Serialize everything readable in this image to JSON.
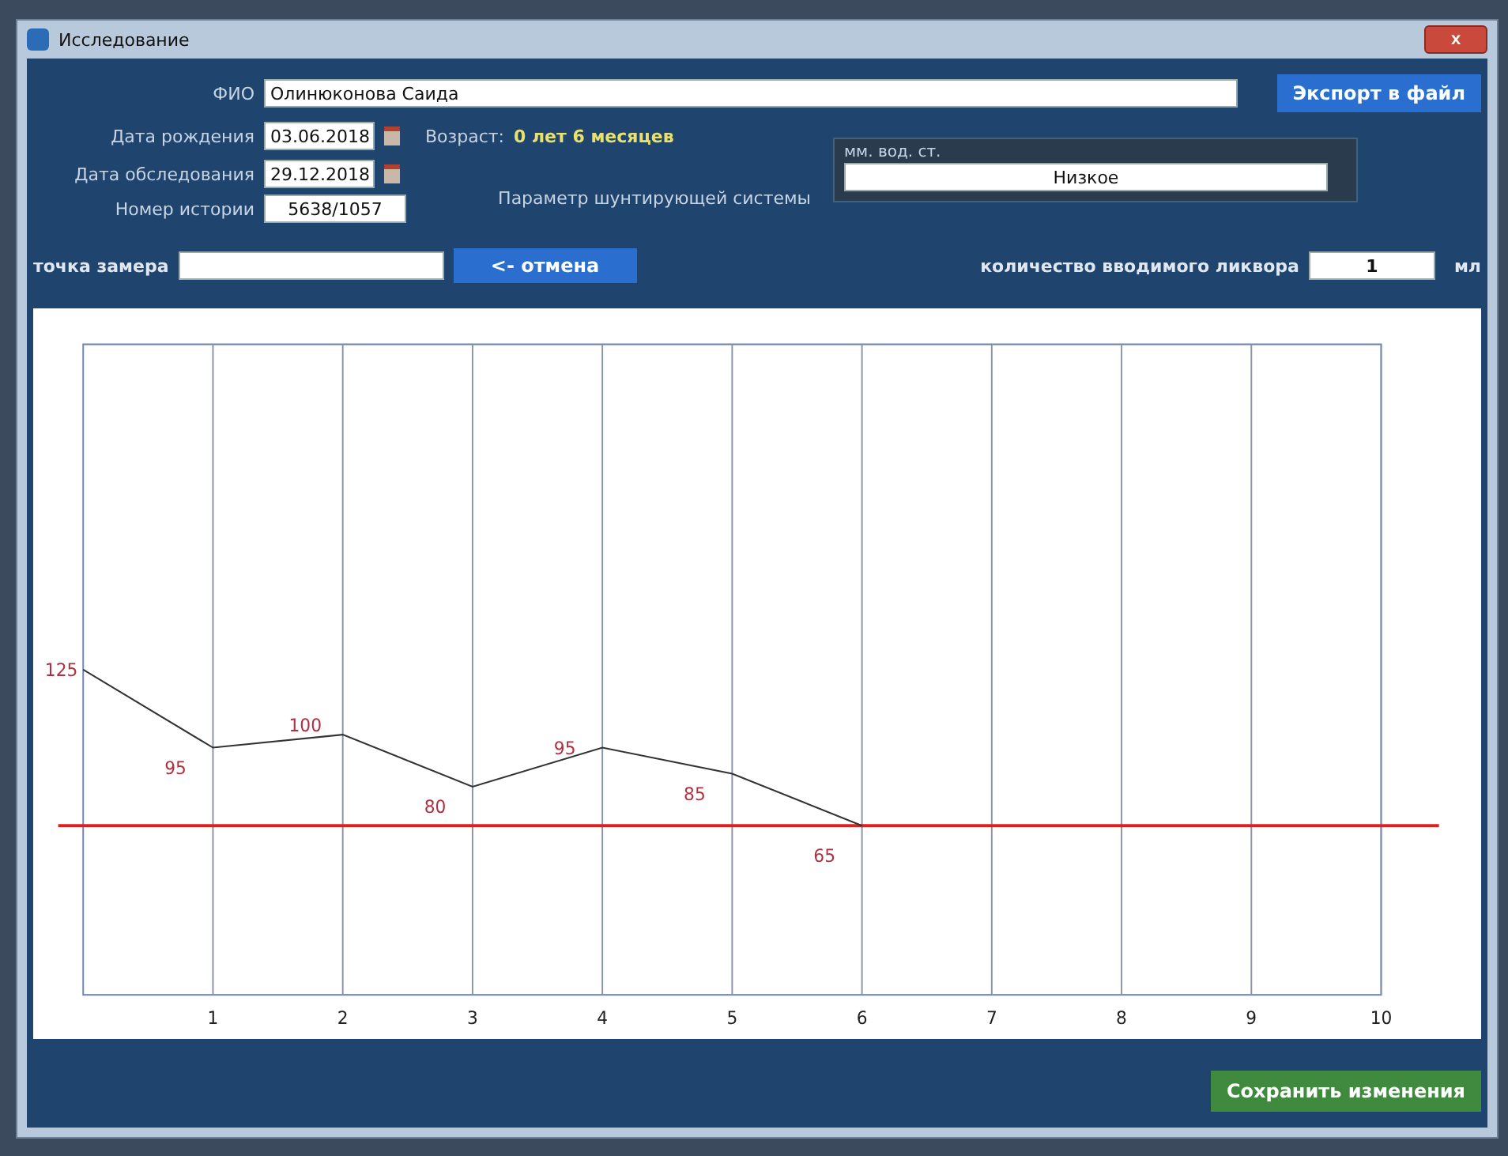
{
  "window": {
    "title": "Исследование",
    "close": "x"
  },
  "fio": {
    "label": "ФИО",
    "value": "Олинюконова Саида"
  },
  "export_button": "Экспорт в файл",
  "birth_date": {
    "label": "Дата рождения",
    "value": "03.06.2018"
  },
  "age": {
    "label": "Возраст:",
    "value": "0 лет 6 месяцев"
  },
  "exam_date": {
    "label": "Дата обследования",
    "value": "29.12.2018"
  },
  "history_number": {
    "label": "Номер истории",
    "value": "5638/1057"
  },
  "shunt_parameter": {
    "label": "Параметр шунтирующей системы",
    "unit": "мм. вод. ст.",
    "value": "Низкое"
  },
  "measure_point": {
    "label": "точка замера",
    "cancel_button": "<- отмена"
  },
  "liquor_amount": {
    "label": "количество вводимого ликвора",
    "value": "1",
    "unit": "мл"
  },
  "chart_data": {
    "type": "line",
    "x": [
      0,
      1,
      2,
      3,
      4,
      5,
      6
    ],
    "xlim": [
      0,
      10
    ],
    "ylim": [
      0,
      250
    ],
    "xticks": [
      {
        "value": 1,
        "label": "1"
      },
      {
        "value": 2,
        "label": "2"
      },
      {
        "value": 3,
        "label": "3"
      },
      {
        "value": 4,
        "label": "4"
      },
      {
        "value": 5,
        "label": "5"
      },
      {
        "value": 6,
        "label": "6"
      },
      {
        "value": 7,
        "label": "7"
      },
      {
        "value": 8,
        "label": "8"
      },
      {
        "value": 9,
        "label": "9"
      },
      {
        "value": 10,
        "label": "10"
      }
    ],
    "series": [
      {
        "color": "#333333",
        "values": [
          125,
          95,
          100,
          80,
          95,
          85,
          65
        ]
      }
    ],
    "data_labels": true,
    "grid": true,
    "ref_lines": [
      {
        "axis": "y",
        "value": 65,
        "color": "#e02020"
      }
    ]
  },
  "save_button": "Сохранить изменения"
}
